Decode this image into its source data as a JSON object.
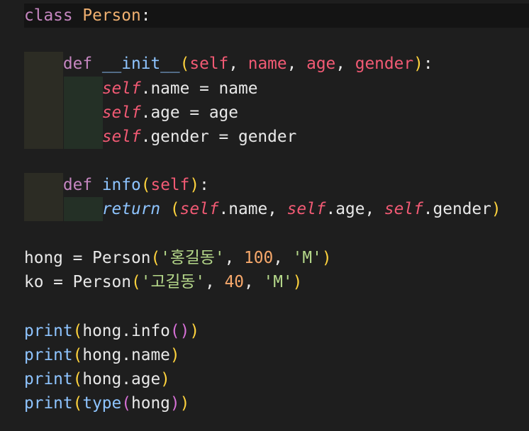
{
  "lines": {
    "l1": {
      "kw": "class",
      "name": "Person",
      "colon": ":"
    },
    "l3": {
      "def": "def",
      "fn": "__init__",
      "p_open": "(",
      "self": "self",
      "c1": ", ",
      "name": "name",
      "c2": ", ",
      "age": "age",
      "c3": ", ",
      "gender": "gender",
      "p_close": ")",
      "colon": ":"
    },
    "l4": {
      "self": "self",
      "attr": ".name",
      "eq": " = ",
      "val": "name"
    },
    "l5": {
      "self": "self",
      "attr": ".age",
      "eq": " = ",
      "val": "age"
    },
    "l6": {
      "self": "self",
      "attr": ".gender",
      "eq": " = ",
      "val": "gender"
    },
    "l8": {
      "def": "def",
      "fn": "info",
      "p_open": "(",
      "self": "self",
      "p_close": ")",
      "colon": ":"
    },
    "l9": {
      "ret": "return",
      "p_open": "(",
      "self1": "self",
      "a1": ".name",
      "c1": ", ",
      "self2": "self",
      "a2": ".age",
      "c2": ", ",
      "self3": "self",
      "a3": ".gender",
      "p_close": ")"
    },
    "l11": {
      "var": "hong",
      "eq": " = ",
      "cls": "Person",
      "p_open": "(",
      "s1": "'홍길동'",
      "c1": ", ",
      "n": "100",
      "c2": ", ",
      "s2": "'M'",
      "p_close": ")"
    },
    "l12": {
      "var": "ko",
      "eq": " = ",
      "cls": "Person",
      "p_open": "(",
      "s1": "'고길동'",
      "c1": ", ",
      "n": "40",
      "c2": ", ",
      "s2": "'M'",
      "p_close": ")"
    },
    "l14": {
      "fn": "print",
      "p_open": "(",
      "obj": "hong",
      "attr": ".info",
      "inner": "()",
      "p_close": ")"
    },
    "l15": {
      "fn": "print",
      "p_open": "(",
      "obj": "hong",
      "attr": ".name",
      "p_close": ")"
    },
    "l16": {
      "fn": "print",
      "p_open": "(",
      "obj": "hong",
      "attr": ".age",
      "p_close": ")"
    },
    "l17": {
      "fn": "print",
      "p_open": "(",
      "builtin": "type",
      "p2_open": "(",
      "obj": "hong",
      "p2_close": ")",
      "p_close": ")"
    }
  }
}
